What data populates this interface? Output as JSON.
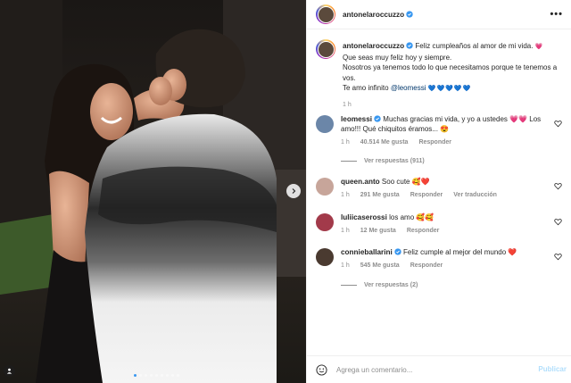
{
  "post": {
    "author": "antonelaroccuzzo",
    "more_label": "•••",
    "caption_author": "antonelaroccuzzo",
    "caption_lines": [
      "Feliz cumpleaños al amor de mi vida.",
      "Que seas muy feliz hoy y siempre.",
      "Nosotros ya tenemos todo lo que necesitamos porque te tenemos a vos.",
      "Te amo infinito"
    ],
    "caption_heart": "💗",
    "caption_mention": "@leomessi",
    "caption_hearts": "💙💙💙💙💙",
    "caption_time": "1 h"
  },
  "comments": [
    {
      "user": "leomessi",
      "verified": true,
      "text": "Muchas gracias mi vida, y yo a ustedes 💗💗 Los amo!!! Qué chiquitos éramos... 😍",
      "time": "1 h",
      "likes": "40.514 Me gusta",
      "reply": "Responder",
      "translation": "",
      "replies": "Ver respuestas (911)"
    },
    {
      "user": "queen.anto",
      "verified": false,
      "text": "Soo cute 🥰❤️",
      "time": "1 h",
      "likes": "291 Me gusta",
      "reply": "Responder",
      "translation": "Ver traducción",
      "replies": ""
    },
    {
      "user": "luliicaserossi",
      "verified": false,
      "text": "los amo 🥰🥰",
      "time": "1 h",
      "likes": "12 Me gusta",
      "reply": "Responder",
      "translation": "",
      "replies": ""
    },
    {
      "user": "connieballarini",
      "verified": true,
      "text": "Feliz cumple al mejor del mundo ❤️",
      "time": "1 h",
      "likes": "545 Me gusta",
      "reply": "Responder",
      "translation": "",
      "replies": "Ver respuestas (2)"
    }
  ],
  "footer": {
    "placeholder": "Agrega un comentario...",
    "post_label": "Publicar"
  },
  "carousel": {
    "slide_count": 9,
    "active_index": 0
  },
  "icons": {
    "verified": "verified-badge-icon",
    "like": "heart-outline-icon",
    "emoji": "emoji-smile-icon",
    "next": "chevron-right-icon",
    "tag": "user-tag-icon"
  },
  "colors": {
    "verified": "#3897f0",
    "mention": "#00376b",
    "muted": "#8e8e8e",
    "post_disabled": "#b2dffc"
  }
}
